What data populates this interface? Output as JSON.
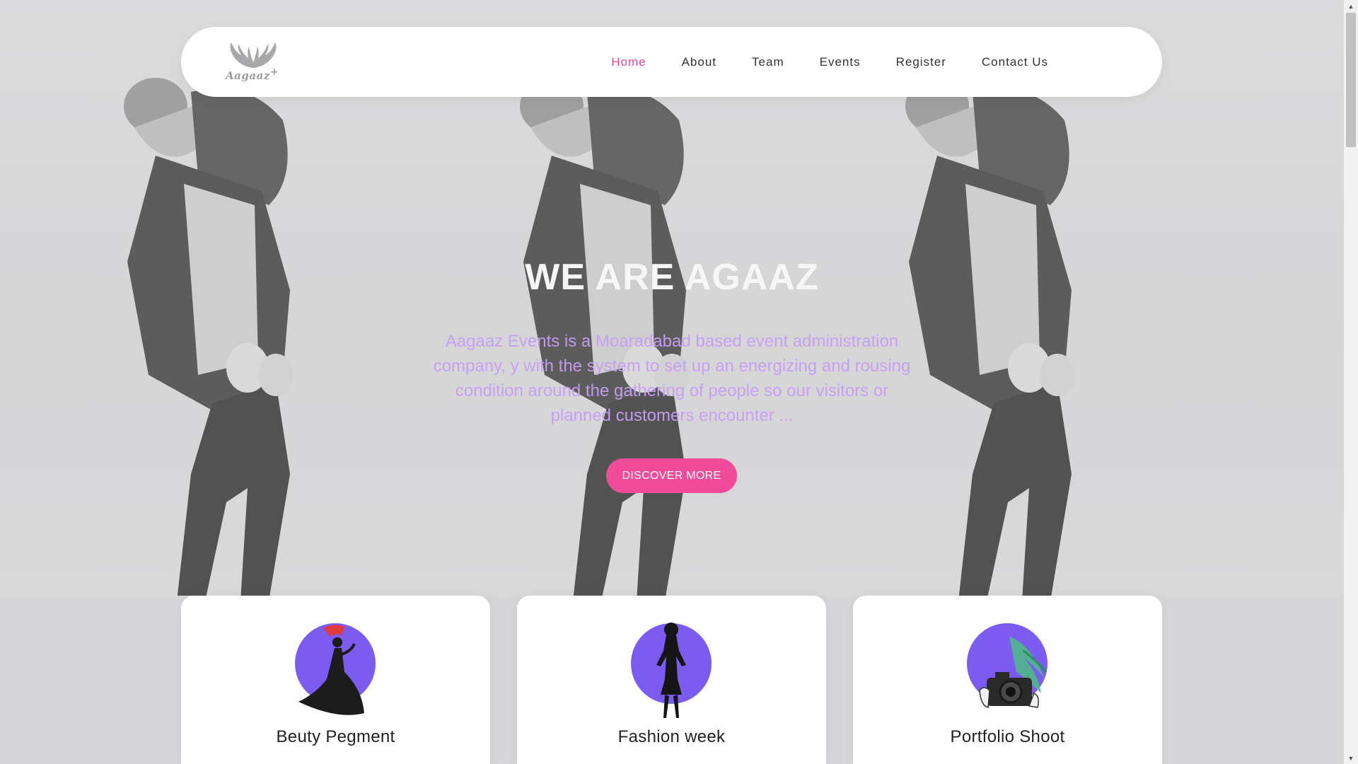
{
  "brand": {
    "logo_text": "Aagaaz",
    "logo_sup": "+"
  },
  "nav": {
    "items": [
      {
        "label": "Home",
        "active": true
      },
      {
        "label": "About"
      },
      {
        "label": "Team"
      },
      {
        "label": "Events"
      },
      {
        "label": "Register"
      },
      {
        "label": "Contact Us"
      }
    ]
  },
  "hero": {
    "title": "WE ARE AGAAZ",
    "text": "Aagaaz Events is a Moaradabad based event administration company, y with the system to set up an energizing and rousing condition around the gathering of people so our visitors or planned customers encounter ...",
    "button": "DISCOVER MORE"
  },
  "cards": [
    {
      "title": "Beuty Pegment",
      "icon": "pageant-dress-icon"
    },
    {
      "title": "Fashion week",
      "icon": "fashion-model-icon"
    },
    {
      "title": "Portfolio Shoot",
      "icon": "camera-icon"
    }
  ],
  "colors": {
    "accent_pink": "#f04c9b",
    "nav_active": "#e8479b",
    "hero_text": "#c79ef6",
    "icon_circle": "#7b5bf0"
  }
}
